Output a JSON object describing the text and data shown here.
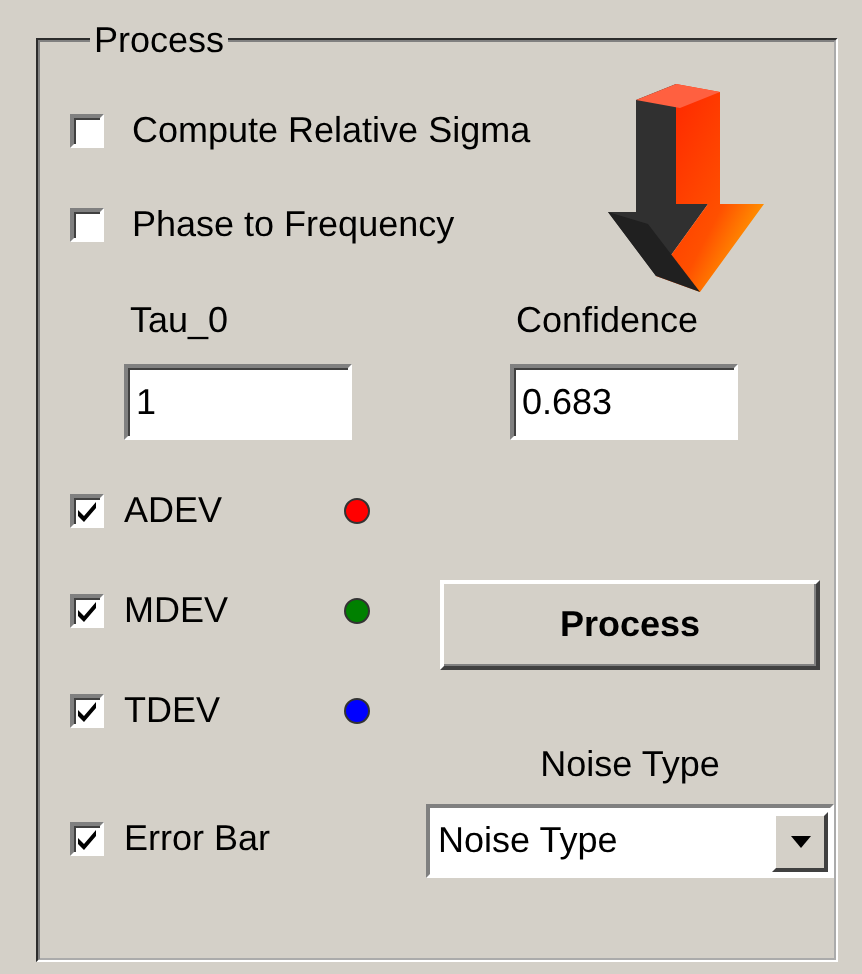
{
  "group": {
    "title": "Process"
  },
  "options": [
    {
      "label": "Compute Relative Sigma",
      "checked": false
    },
    {
      "label": "Phase to Frequency",
      "checked": false
    }
  ],
  "params": [
    {
      "label": "Tau_0",
      "value": "1"
    },
    {
      "label": "Confidence",
      "value": "0.683"
    }
  ],
  "series": [
    {
      "label": "ADEV",
      "checked": true,
      "color": "#ff0000"
    },
    {
      "label": "MDEV",
      "checked": true,
      "color": "#008000"
    },
    {
      "label": "TDEV",
      "checked": true,
      "color": "#0000ff"
    }
  ],
  "error_bar": {
    "label": "Error Bar",
    "checked": true
  },
  "process_button": "Process",
  "noise_type": {
    "label": "Noise Type",
    "value": "Noise Type"
  }
}
